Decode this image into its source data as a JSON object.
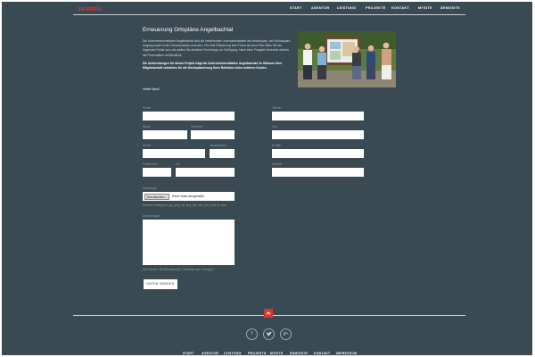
{
  "header": {
    "logo": "mantis",
    "nav": [
      "START",
      "AGENTUR",
      "LEISTUNG",
      "PROJEKTE",
      "KONTAKT",
      "MYSITE",
      "DEMOSITE"
    ]
  },
  "content": {
    "title": "Erneuerung Ortspläne Angelbachtal",
    "intro": "Die Unternehmerinitiative Angelbachtal wird die bestehenden Informationstafeln am Heckerplatz, am Schlosspark­eingang sowie in der Friedrichstraße erneuern. Für eine Platzierung Ihrer Firma auf dem Plan füllen Sie die folgenden Felder aus und stellen Sie aktuelles Firmenlogo zur Verfügung. Nach einer Freigabe ihrerseits werden die Firmendaten veröffentlicht.",
    "notice": "Die Aufwendungen für dieses Projekt trägt die Unternehmerinitiative Angelbachtal. Im Rahmen Ihrer Mitgliedschaft entstehen für die Werbeplatzierung Ihres Betriebes keine weiteren Kosten.",
    "thanks": "Vielen Dank!"
  },
  "form": {
    "labels": {
      "firma": "Firma*",
      "name": "Name",
      "vorname": "Vorname*",
      "strasse": "Straße",
      "hausnummer": "Hausnummer",
      "plz": "Postleitzahl",
      "ort": "Ort",
      "telefon": "Telefon*",
      "fax": "Fax",
      "email": "E-Mail*",
      "website": "Website",
      "logo": "Firmenlogo",
      "formats": "Erlaubte Dateitypen: jpg, jpeg, gif, png, pdf, eps, psd, indd, tif, bmp",
      "anmerkungen": "Anmerkungen",
      "hinweis": "Hier können Sie Bemerkungen, Hinweise usw. eintragen."
    },
    "file_button": "Durchsuchen...",
    "file_status": "Keine Datei ausgewählt.",
    "submit": "DATEN SENDEN"
  },
  "footer": {
    "totop_icon": "chevron-up-icon",
    "social": [
      "facebook-icon",
      "twitter-icon",
      "google-plus-icon"
    ],
    "nav": [
      "START",
      "AGENTUR",
      "LEISTUNG",
      "PROJEKTE",
      "MYSITE",
      "DEMOSITE",
      "KONTAKT",
      "IMPRESSUM"
    ]
  },
  "colors": {
    "background": "#3a4a52",
    "accent": "#d9362e"
  }
}
